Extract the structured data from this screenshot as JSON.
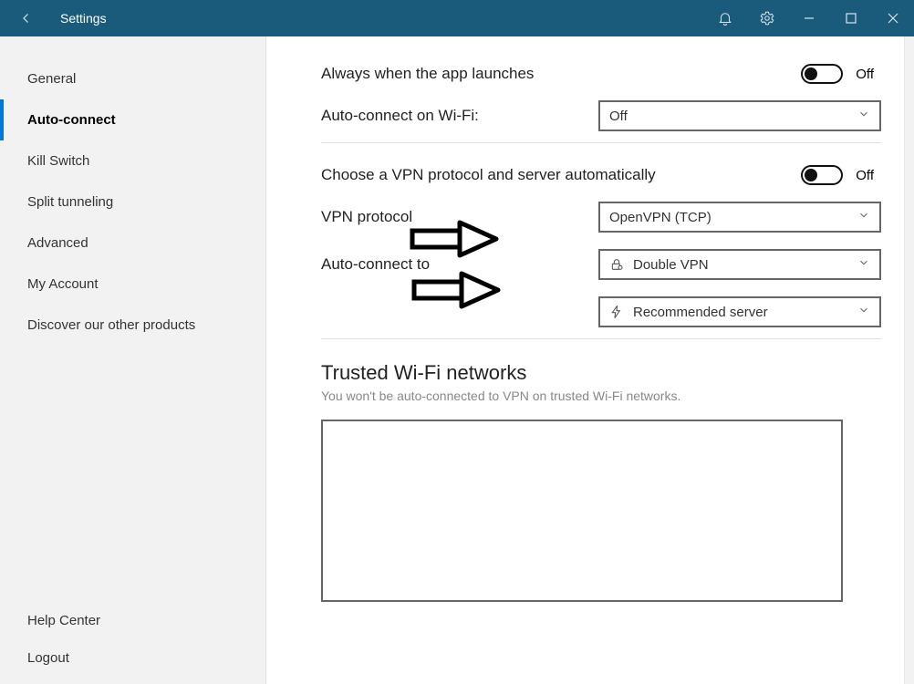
{
  "titlebar": {
    "title": "Settings"
  },
  "sidebar": {
    "items": [
      {
        "label": "General"
      },
      {
        "label": "Auto-connect"
      },
      {
        "label": "Kill Switch"
      },
      {
        "label": "Split tunneling"
      },
      {
        "label": "Advanced"
      },
      {
        "label": "My Account"
      },
      {
        "label": "Discover our other products"
      }
    ],
    "footer": [
      {
        "label": "Help Center"
      },
      {
        "label": "Logout"
      }
    ]
  },
  "main": {
    "always_launch_label": "Always when the app launches",
    "always_launch_state": "Off",
    "wifi_label": "Auto-connect on Wi-Fi:",
    "wifi_value": "Off",
    "auto_proto_label": "Choose a VPN protocol and server automatically",
    "auto_proto_state": "Off",
    "vpn_protocol_label": "VPN protocol",
    "vpn_protocol_value": "OpenVPN (TCP)",
    "connect_to_label": "Auto-connect to",
    "connect_to_value": "Double VPN",
    "recommended_value": "Recommended server",
    "trusted_title": "Trusted Wi-Fi networks",
    "trusted_sub": "You won't be auto-connected to VPN on trusted Wi-Fi networks."
  }
}
